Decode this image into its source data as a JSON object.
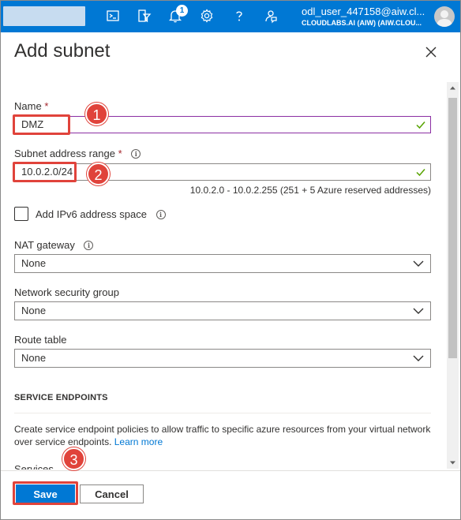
{
  "topbar": {
    "notification_count": "1",
    "user_name": "odl_user_447158@aiw.cl...",
    "user_tenant": "CLOUDLABS.AI (AIW) (AIW.CLOU...",
    "icons": [
      "cloud-shell-icon",
      "directory-filter-icon",
      "notifications-icon",
      "settings-icon",
      "help-icon",
      "feedback-icon"
    ]
  },
  "panel": {
    "title": "Add subnet"
  },
  "form": {
    "name_label": "Name",
    "name_value": "DMZ",
    "range_label": "Subnet address range",
    "range_value": "10.0.2.0/24",
    "range_hint": "10.0.2.0 - 10.0.2.255 (251 + 5 Azure reserved addresses)",
    "ipv6_label": "Add IPv6 address space",
    "nat_label": "NAT gateway",
    "nat_value": "None",
    "nsg_label": "Network security group",
    "nsg_value": "None",
    "route_label": "Route table",
    "route_value": "None",
    "required_mark": "*",
    "info_glyph": "i"
  },
  "endpoints": {
    "heading": "SERVICE ENDPOINTS",
    "description": "Create service endpoint policies to allow traffic to specific azure resources from your virtual network over service endpoints.",
    "learn_more": "Learn more",
    "services_label": "Services"
  },
  "footer": {
    "save_label": "Save",
    "cancel_label": "Cancel"
  },
  "annotations": {
    "step1": "1",
    "step2": "2",
    "step3": "3",
    "color": "#e0433b"
  },
  "colors": {
    "accent": "#0078d4",
    "focus_border": "#8b2fa3",
    "valid_check": "#57a300",
    "required": "#a4262c"
  }
}
